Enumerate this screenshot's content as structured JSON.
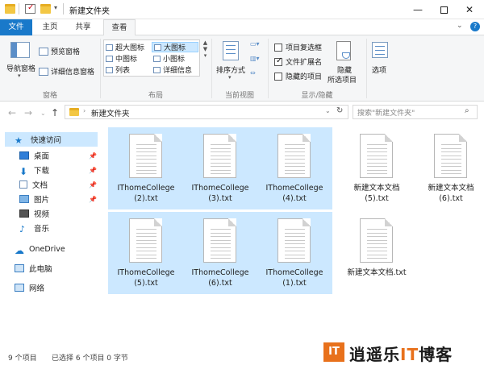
{
  "window": {
    "title": "新建文件夹"
  },
  "tabs": [
    "文件",
    "主页",
    "共享",
    "查看"
  ],
  "ribbon": {
    "panes": {
      "nav_pane": "导航窗格",
      "preview_pane": "预览窗格",
      "details_pane": "详细信息窗格",
      "group_label": "窗格"
    },
    "layout": {
      "extra_large": "超大图标",
      "large": "大图标",
      "medium": "中图标",
      "small": "小图标",
      "list": "列表",
      "details": "详细信息",
      "group_label": "布局"
    },
    "current_view": {
      "sort_by": "排序方式",
      "group_label": "当前视图"
    },
    "show_hide": {
      "item_checkboxes": "项目复选框",
      "file_extensions": "文件扩展名",
      "hidden_items": "隐藏的项目",
      "hide_selected_line1": "隐藏",
      "hide_selected_line2": "所选项目",
      "group_label": "显示/隐藏"
    },
    "options": "选项"
  },
  "address": {
    "path": "新建文件夹",
    "search_placeholder": "搜索\"新建文件夹\""
  },
  "nav": {
    "quick_access": "快速访问",
    "items": [
      "桌面",
      "下载",
      "文档",
      "图片",
      "视频",
      "音乐"
    ],
    "onedrive": "OneDrive",
    "this_pc": "此电脑",
    "network": "网络"
  },
  "files": [
    {
      "line1": "IThomeCollege",
      "line2": "(2).txt",
      "selected": true
    },
    {
      "line1": "IThomeCollege",
      "line2": "(3).txt",
      "selected": true
    },
    {
      "line1": "IThomeCollege",
      "line2": "(4).txt",
      "selected": true
    },
    {
      "line1": "新建文本文档",
      "line2": "(5).txt",
      "selected": false
    },
    {
      "line1": "新建文本文档",
      "line2": "(6).txt",
      "selected": false
    },
    {
      "line1": "IThomeCollege",
      "line2": "(5).txt",
      "selected": true
    },
    {
      "line1": "IThomeCollege",
      "line2": "(6).txt",
      "selected": true
    },
    {
      "line1": "IThomeCollege",
      "line2": "(1).txt",
      "selected": true
    },
    {
      "line1": "新建文本文档.txt",
      "line2": "",
      "selected": false
    }
  ],
  "status": {
    "item_count": "9 个项目",
    "selection": "已选择 6 个项目  0 字节"
  },
  "watermark": {
    "logo": "IT",
    "text_pre": "逍遥乐",
    "text_it": "IT",
    "text_post": "博客"
  },
  "colors": {
    "accent": "#1979ca",
    "selection": "#cce8ff",
    "folder": "#f3c744",
    "watermark": "#e8711c"
  }
}
